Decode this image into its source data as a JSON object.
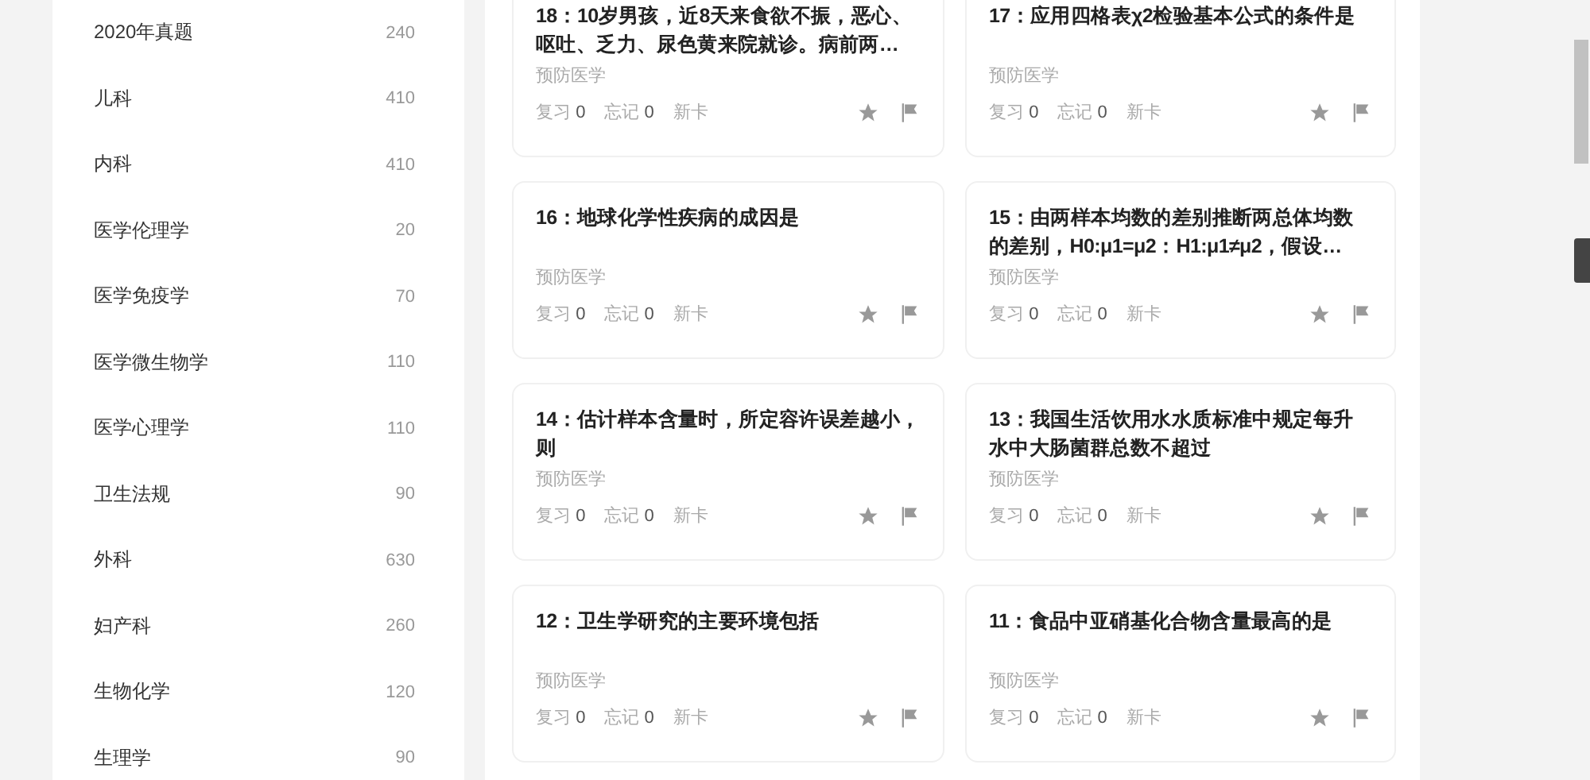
{
  "sidebar": {
    "items": [
      {
        "label": "2020年真题",
        "count": "240"
      },
      {
        "label": "儿科",
        "count": "410"
      },
      {
        "label": "内科",
        "count": "410"
      },
      {
        "label": "医学伦理学",
        "count": "20"
      },
      {
        "label": "医学免疫学",
        "count": "70"
      },
      {
        "label": "医学微生物学",
        "count": "110"
      },
      {
        "label": "医学心理学",
        "count": "110"
      },
      {
        "label": "卫生法规",
        "count": "90"
      },
      {
        "label": "外科",
        "count": "630"
      },
      {
        "label": "妇产科",
        "count": "260"
      },
      {
        "label": "生物化学",
        "count": "120"
      },
      {
        "label": "生理学",
        "count": "90"
      }
    ]
  },
  "cards": [
    {
      "title": "18：10岁男孩，近8天来食欲不振，恶心、呕吐、乏力、尿色黄来院就诊。病前两…",
      "category": "预防医学",
      "stats": [
        {
          "label": "复习",
          "value": "0"
        },
        {
          "label": "忘记",
          "value": "0"
        },
        {
          "label": "新卡"
        }
      ],
      "starred": false,
      "flagged": false
    },
    {
      "title": "17：应用四格表χ2检验基本公式的条件是",
      "category": "预防医学",
      "stats": [
        {
          "label": "复习",
          "value": "0"
        },
        {
          "label": "忘记",
          "value": "0"
        },
        {
          "label": "新卡"
        }
      ],
      "starred": false,
      "flagged": false
    },
    {
      "title": "16：地球化学性疾病的成因是",
      "category": "预防医学",
      "stats": [
        {
          "label": "复习",
          "value": "0"
        },
        {
          "label": "忘记",
          "value": "0"
        },
        {
          "label": "新卡"
        }
      ],
      "starred": false,
      "flagged": false
    },
    {
      "title": "15：由两样本均数的差别推断两总体均数的差别，H0:μ1=μ2：H1:μ1≠μ2，假设…",
      "category": "预防医学",
      "stats": [
        {
          "label": "复习",
          "value": "0"
        },
        {
          "label": "忘记",
          "value": "0"
        },
        {
          "label": "新卡"
        }
      ],
      "starred": false,
      "flagged": false
    },
    {
      "title": "14：估计样本含量时，所定容许误差越小，则",
      "category": "预防医学",
      "stats": [
        {
          "label": "复习",
          "value": "0"
        },
        {
          "label": "忘记",
          "value": "0"
        },
        {
          "label": "新卡"
        }
      ],
      "starred": false,
      "flagged": false
    },
    {
      "title": "13：我国生活饮用水水质标准中规定每升水中大肠菌群总数不超过",
      "category": "预防医学",
      "stats": [
        {
          "label": "复习",
          "value": "0"
        },
        {
          "label": "忘记",
          "value": "0"
        },
        {
          "label": "新卡"
        }
      ],
      "starred": false,
      "flagged": false
    },
    {
      "title": "12：卫生学研究的主要环境包括",
      "category": "预防医学",
      "stats": [
        {
          "label": "复习",
          "value": "0"
        },
        {
          "label": "忘记",
          "value": "0"
        },
        {
          "label": "新卡"
        }
      ],
      "starred": false,
      "flagged": false
    },
    {
      "title": "11：食品中亚硝基化合物含量最高的是",
      "category": "预防医学",
      "stats": [
        {
          "label": "复习",
          "value": "0"
        },
        {
          "label": "忘记",
          "value": "0"
        },
        {
          "label": "新卡"
        }
      ],
      "starred": false,
      "flagged": false
    }
  ]
}
